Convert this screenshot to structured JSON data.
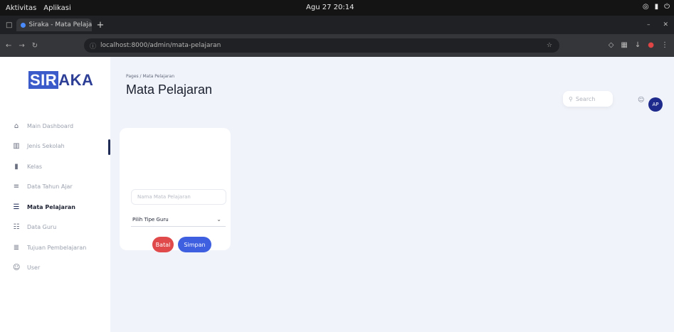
{
  "os_bar": {
    "left_items": [
      "Aktivitas",
      "Aplikasi"
    ],
    "clock": "Agu 27  20:14",
    "right_icons": [
      "network-icon",
      "battery-icon",
      "power-icon"
    ]
  },
  "browser": {
    "tab_title": "Siraka - Mata Pelajaran",
    "new_tab": "+",
    "url": "localhost:8000/admin/mata-pelajaran",
    "window_controls": [
      "–",
      "✕"
    ]
  },
  "sidebar": {
    "logo_si": "SIR",
    "logo_aka": "AKA",
    "items": [
      {
        "icon": "⌂",
        "label": "Main Dashboard"
      },
      {
        "icon": "▥",
        "label": "Jenis Sekolah"
      },
      {
        "icon": "▮",
        "label": "Kelas"
      },
      {
        "icon": "≡",
        "label": "Data Tahun Ajar"
      },
      {
        "icon": "☰",
        "label": "Mata Pelajaran"
      },
      {
        "icon": "☷",
        "label": "Data Guru"
      },
      {
        "icon": "≣",
        "label": "Tujuan Pembelajaran"
      },
      {
        "icon": "☺",
        "label": "User"
      }
    ]
  },
  "header": {
    "breadcrumb": "Pages / Mata Pelajaran",
    "title": "Mata Pelajaran",
    "search_placeholder": "Search",
    "search_icon": "⚲",
    "user_icon": "☺",
    "avatar_initials": "AP"
  },
  "form": {
    "name_placeholder": "Nama Mata Pelajaran",
    "select_value": "Pilih Tipe Guru",
    "chevron": "⌄",
    "reset_label": "Batal",
    "submit_label": "Simpan"
  }
}
